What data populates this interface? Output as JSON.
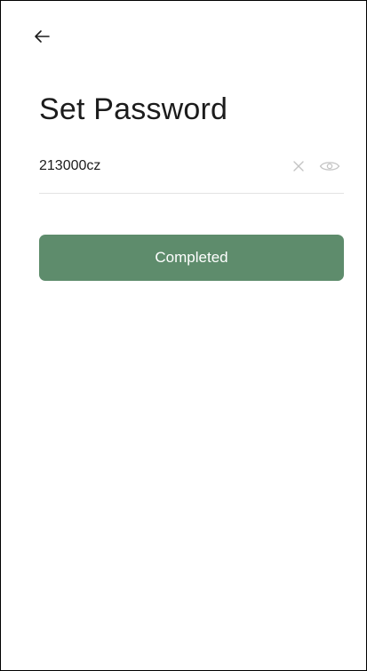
{
  "header": {
    "back_icon": "arrow-left-icon"
  },
  "page": {
    "title": "Set Password"
  },
  "password_field": {
    "value": "213000cz",
    "placeholder": "",
    "clear_icon": "close-icon",
    "visibility_icon": "eye-icon"
  },
  "actions": {
    "submit_label": "Completed"
  },
  "colors": {
    "accent": "#5e8c6c",
    "text": "#1c1c1c",
    "muted_icon": "#c4c4c4",
    "divider": "#e3e3e3"
  }
}
